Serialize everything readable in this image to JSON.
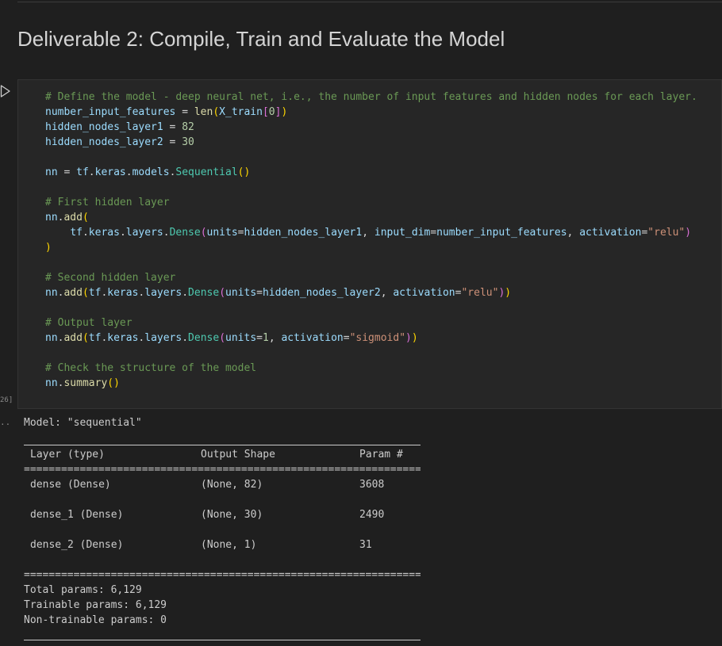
{
  "heading": "Deliverable 2: Compile, Train and Evaluate the Model",
  "execution_count": "26]",
  "output_toggle": "..",
  "code_lines": [
    [
      {
        "t": "# Define the model - deep neural net, i.e., the number of input features and hidden nodes for each layer.",
        "c": "com"
      }
    ],
    [
      {
        "t": "number_input_features",
        "c": "var"
      },
      {
        "t": " = ",
        "c": "op"
      },
      {
        "t": "len",
        "c": "fn"
      },
      {
        "t": "(",
        "c": "br1"
      },
      {
        "t": "X_train",
        "c": "var"
      },
      {
        "t": "[",
        "c": "br2"
      },
      {
        "t": "0",
        "c": "num"
      },
      {
        "t": "]",
        "c": "br2"
      },
      {
        "t": ")",
        "c": "br1"
      }
    ],
    [
      {
        "t": "hidden_nodes_layer1",
        "c": "var"
      },
      {
        "t": " = ",
        "c": "op"
      },
      {
        "t": "82",
        "c": "num"
      }
    ],
    [
      {
        "t": "hidden_nodes_layer2",
        "c": "var"
      },
      {
        "t": " = ",
        "c": "op"
      },
      {
        "t": "30",
        "c": "num"
      }
    ],
    [],
    [
      {
        "t": "nn",
        "c": "var"
      },
      {
        "t": " = ",
        "c": "op"
      },
      {
        "t": "tf",
        "c": "var"
      },
      {
        "t": ".",
        "c": "op"
      },
      {
        "t": "keras",
        "c": "var"
      },
      {
        "t": ".",
        "c": "op"
      },
      {
        "t": "models",
        "c": "var"
      },
      {
        "t": ".",
        "c": "op"
      },
      {
        "t": "Sequential",
        "c": "ns"
      },
      {
        "t": "()",
        "c": "br1"
      }
    ],
    [],
    [
      {
        "t": "# First hidden layer",
        "c": "com"
      }
    ],
    [
      {
        "t": "nn",
        "c": "var"
      },
      {
        "t": ".",
        "c": "op"
      },
      {
        "t": "add",
        "c": "fn"
      },
      {
        "t": "(",
        "c": "br1"
      }
    ],
    [
      {
        "t": "    ",
        "c": "op"
      },
      {
        "t": "tf",
        "c": "var"
      },
      {
        "t": ".",
        "c": "op"
      },
      {
        "t": "keras",
        "c": "var"
      },
      {
        "t": ".",
        "c": "op"
      },
      {
        "t": "layers",
        "c": "var"
      },
      {
        "t": ".",
        "c": "op"
      },
      {
        "t": "Dense",
        "c": "ns"
      },
      {
        "t": "(",
        "c": "br2"
      },
      {
        "t": "units",
        "c": "var"
      },
      {
        "t": "=",
        "c": "op"
      },
      {
        "t": "hidden_nodes_layer1",
        "c": "var"
      },
      {
        "t": ", ",
        "c": "op"
      },
      {
        "t": "input_dim",
        "c": "var"
      },
      {
        "t": "=",
        "c": "op"
      },
      {
        "t": "number_input_features",
        "c": "var"
      },
      {
        "t": ", ",
        "c": "op"
      },
      {
        "t": "activation",
        "c": "var"
      },
      {
        "t": "=",
        "c": "op"
      },
      {
        "t": "\"relu\"",
        "c": "str"
      },
      {
        "t": ")",
        "c": "br2"
      }
    ],
    [
      {
        "t": ")",
        "c": "br1"
      }
    ],
    [],
    [
      {
        "t": "# Second hidden layer",
        "c": "com"
      }
    ],
    [
      {
        "t": "nn",
        "c": "var"
      },
      {
        "t": ".",
        "c": "op"
      },
      {
        "t": "add",
        "c": "fn"
      },
      {
        "t": "(",
        "c": "br1"
      },
      {
        "t": "tf",
        "c": "var"
      },
      {
        "t": ".",
        "c": "op"
      },
      {
        "t": "keras",
        "c": "var"
      },
      {
        "t": ".",
        "c": "op"
      },
      {
        "t": "layers",
        "c": "var"
      },
      {
        "t": ".",
        "c": "op"
      },
      {
        "t": "Dense",
        "c": "ns"
      },
      {
        "t": "(",
        "c": "br2"
      },
      {
        "t": "units",
        "c": "var"
      },
      {
        "t": "=",
        "c": "op"
      },
      {
        "t": "hidden_nodes_layer2",
        "c": "var"
      },
      {
        "t": ", ",
        "c": "op"
      },
      {
        "t": "activation",
        "c": "var"
      },
      {
        "t": "=",
        "c": "op"
      },
      {
        "t": "\"relu\"",
        "c": "str"
      },
      {
        "t": ")",
        "c": "br2"
      },
      {
        "t": ")",
        "c": "br1"
      }
    ],
    [],
    [
      {
        "t": "# Output layer",
        "c": "com"
      }
    ],
    [
      {
        "t": "nn",
        "c": "var"
      },
      {
        "t": ".",
        "c": "op"
      },
      {
        "t": "add",
        "c": "fn"
      },
      {
        "t": "(",
        "c": "br1"
      },
      {
        "t": "tf",
        "c": "var"
      },
      {
        "t": ".",
        "c": "op"
      },
      {
        "t": "keras",
        "c": "var"
      },
      {
        "t": ".",
        "c": "op"
      },
      {
        "t": "layers",
        "c": "var"
      },
      {
        "t": ".",
        "c": "op"
      },
      {
        "t": "Dense",
        "c": "ns"
      },
      {
        "t": "(",
        "c": "br2"
      },
      {
        "t": "units",
        "c": "var"
      },
      {
        "t": "=",
        "c": "op"
      },
      {
        "t": "1",
        "c": "num"
      },
      {
        "t": ", ",
        "c": "op"
      },
      {
        "t": "activation",
        "c": "var"
      },
      {
        "t": "=",
        "c": "op"
      },
      {
        "t": "\"sigmoid\"",
        "c": "str"
      },
      {
        "t": ")",
        "c": "br2"
      },
      {
        "t": ")",
        "c": "br1"
      }
    ],
    [],
    [
      {
        "t": "# Check the structure of the model",
        "c": "com"
      }
    ],
    [
      {
        "t": "nn",
        "c": "var"
      },
      {
        "t": ".",
        "c": "op"
      },
      {
        "t": "summary",
        "c": "fn"
      },
      {
        "t": "()",
        "c": "br1"
      }
    ]
  ],
  "output": {
    "model_line": "Model: \"sequential\"",
    "headers": [
      "Layer (type)",
      "Output Shape",
      "Param #"
    ],
    "rows": [
      [
        "dense (Dense)",
        "(None, 82)",
        "3608"
      ],
      [
        "dense_1 (Dense)",
        "(None, 30)",
        "2490"
      ],
      [
        "dense_2 (Dense)",
        "(None, 1)",
        "31"
      ]
    ],
    "double_rule": "=================================================================",
    "total_params": "Total params: 6,129",
    "trainable_params": "Trainable params: 6,129",
    "non_trainable_params": "Non-trainable params: 0"
  },
  "icons": {
    "run": "play-outline-icon"
  }
}
